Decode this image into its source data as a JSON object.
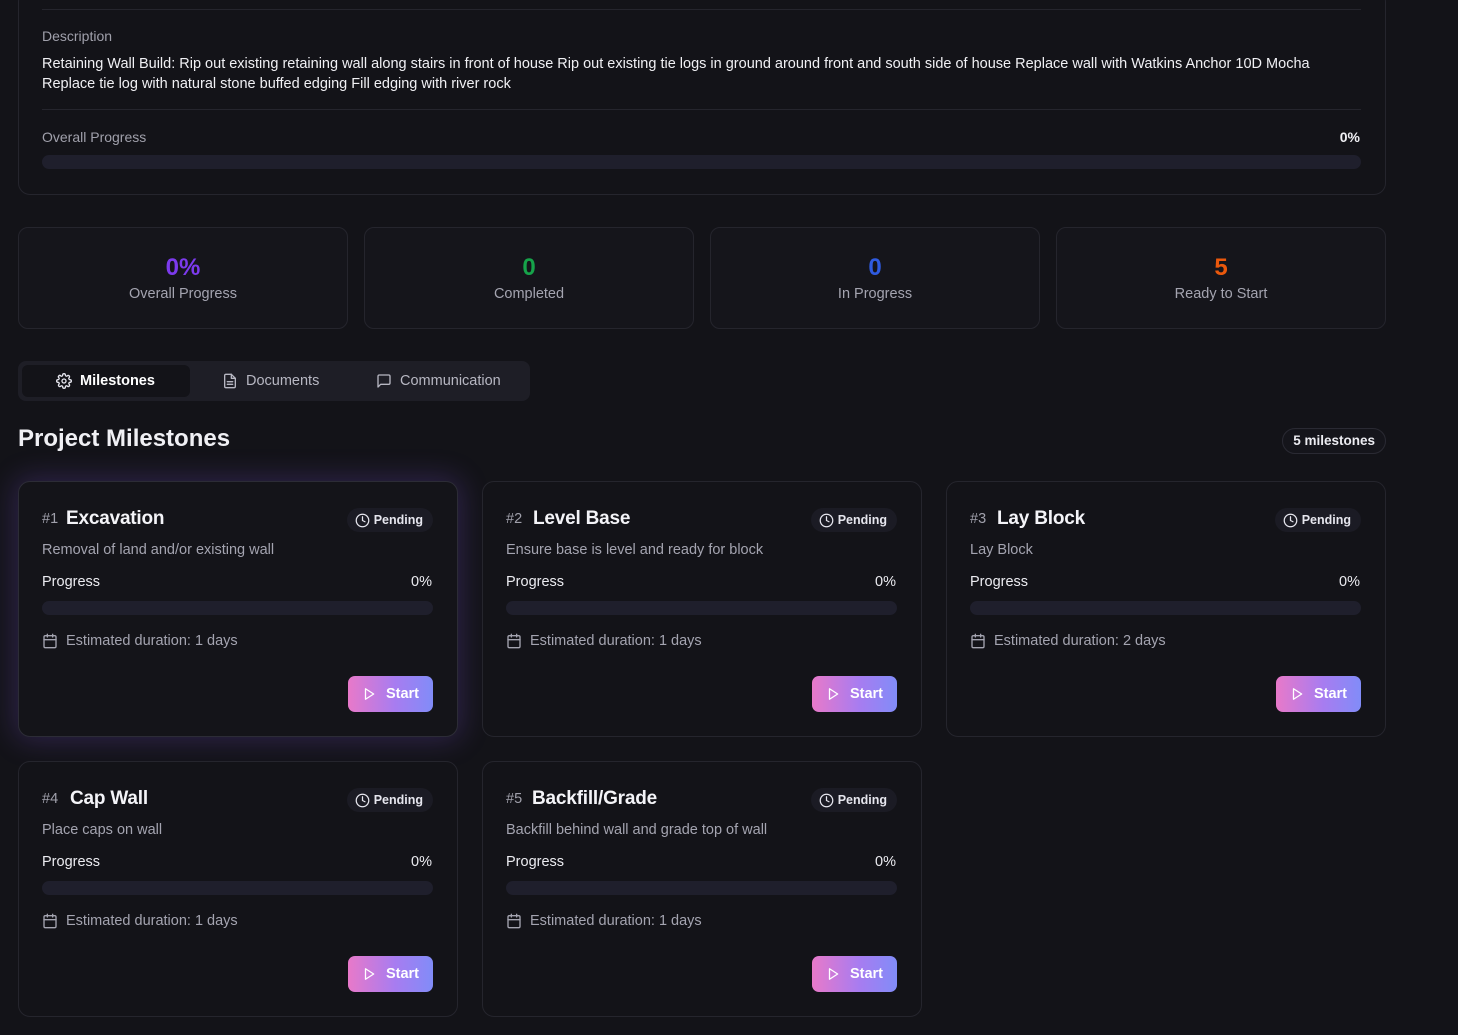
{
  "description": {
    "label": "Description",
    "text": "Retaining Wall Build: Rip out existing retaining wall along stairs in front of house Rip out existing tie logs in ground around front and south side of house Replace wall with Watkins Anchor 10D Mocha Replace tie log with natural stone buffed edging Fill edging with river rock",
    "overall_label": "Overall Progress",
    "overall_value": "0%",
    "overall_fraction": 0
  },
  "stats": [
    {
      "value": "0%",
      "label": "Overall Progress",
      "color": "#7c3aed"
    },
    {
      "value": "0",
      "label": "Completed",
      "color": "#16a34a"
    },
    {
      "value": "0",
      "label": "In Progress",
      "color": "#2f5be0"
    },
    {
      "value": "5",
      "label": "Ready to Start",
      "color": "#ea580c"
    }
  ],
  "tabs": [
    {
      "label": "Milestones",
      "icon": "gear-icon",
      "active": true
    },
    {
      "label": "Documents",
      "icon": "document-icon",
      "active": false
    },
    {
      "label": "Communication",
      "icon": "message-icon",
      "active": false
    }
  ],
  "section": {
    "title": "Project Milestones",
    "count": "5 milestones"
  },
  "milestones": [
    {
      "num": "#1",
      "title": "Excavation",
      "status": "Pending",
      "description": "Removal of land and/or existing wall",
      "progress_label": "Progress",
      "progress_value": "0%",
      "progress_fraction": 0,
      "duration": "Estimated duration: 1 days",
      "action": "Start"
    },
    {
      "num": "#2",
      "title": "Level Base",
      "status": "Pending",
      "description": "Ensure base is level and ready for block",
      "progress_label": "Progress",
      "progress_value": "0%",
      "progress_fraction": 0,
      "duration": "Estimated duration: 1 days",
      "action": "Start"
    },
    {
      "num": "#3",
      "title": "Lay Block",
      "status": "Pending",
      "description": "Lay Block",
      "progress_label": "Progress",
      "progress_value": "0%",
      "progress_fraction": 0,
      "duration": "Estimated duration: 2 days",
      "action": "Start"
    },
    {
      "num": "#4",
      "title": "Cap Wall",
      "status": "Pending",
      "description": "Place caps on wall",
      "progress_label": "Progress",
      "progress_value": "0%",
      "progress_fraction": 0,
      "duration": "Estimated duration: 1 days",
      "action": "Start"
    },
    {
      "num": "#5",
      "title": "Backfill/Grade",
      "status": "Pending",
      "description": "Backfill behind wall and grade top of wall",
      "progress_label": "Progress",
      "progress_value": "0%",
      "progress_fraction": 0,
      "duration": "Estimated duration: 1 days",
      "action": "Start"
    }
  ]
}
